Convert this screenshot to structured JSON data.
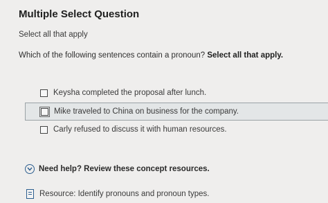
{
  "title": "Multiple Select Question",
  "instruction": "Select all that apply",
  "question": {
    "text": "Which of the following sentences contain a pronoun?",
    "emphasis": "Select all that apply."
  },
  "options": [
    {
      "label": "Keysha completed the proposal after lunch."
    },
    {
      "label": "Mike traveled to China on business for the company."
    },
    {
      "label": "Carly refused to discuss it with human resources."
    }
  ],
  "help": {
    "label": "Need help? Review these concept resources."
  },
  "resource": {
    "label": "Resource: Identify pronouns and pronoun types."
  },
  "colors": {
    "accent": "#2c5e8f",
    "highlight": "#e3e6e7"
  }
}
